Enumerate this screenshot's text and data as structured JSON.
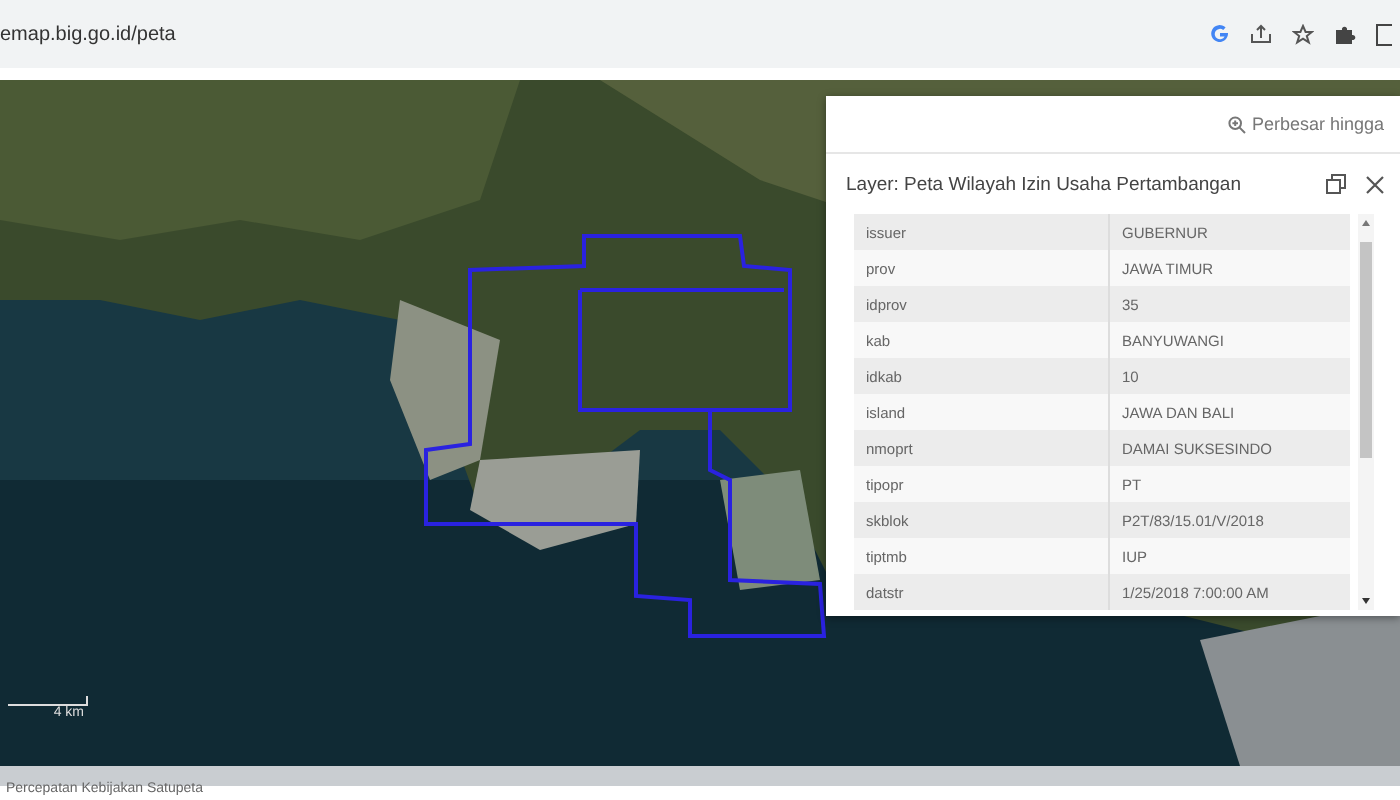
{
  "browser": {
    "url": "emap.big.go.id/peta"
  },
  "map": {
    "scale_label": "4 km",
    "attribution": "Percepatan Kebijakan Satupeta"
  },
  "popup": {
    "zoom_link": "Perbesar hingga",
    "title": "Layer: Peta Wilayah Izin Usaha Pertambangan",
    "attributes": [
      {
        "field": "issuer",
        "value": "GUBERNUR"
      },
      {
        "field": "prov",
        "value": "JAWA TIMUR"
      },
      {
        "field": "idprov",
        "value": "35"
      },
      {
        "field": "kab",
        "value": "BANYUWANGI"
      },
      {
        "field": "idkab",
        "value": "10"
      },
      {
        "field": "island",
        "value": "JAWA DAN BALI"
      },
      {
        "field": "nmoprt",
        "value": "DAMAI SUKSESINDO"
      },
      {
        "field": "tipopr",
        "value": "PT"
      },
      {
        "field": "skblok",
        "value": "P2T/83/15.01/V/2018"
      },
      {
        "field": "tiptmb",
        "value": "IUP"
      },
      {
        "field": "datstr",
        "value": "1/25/2018 7:00:00 AM"
      }
    ]
  }
}
